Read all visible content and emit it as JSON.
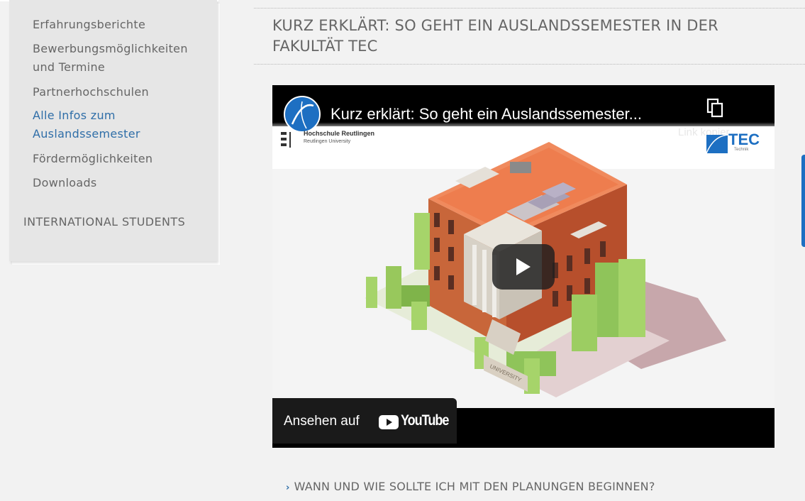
{
  "sidebar": {
    "items": [
      {
        "label": "Erfahrungsberichte"
      },
      {
        "label": "Bewerbungsmöglichkeiten und Termine"
      },
      {
        "label": "Partnerhochschulen"
      },
      {
        "label": "Alle Infos zum Auslandssemester",
        "active": true
      },
      {
        "label": "Fördermöglichkeiten"
      },
      {
        "label": "Downloads"
      }
    ],
    "section_header": "INTERNATIONAL STUDENTS"
  },
  "main": {
    "title": "KURZ ERKLÄRT: SO GEHT EIN AUSLANDSSEMESTER IN DER FAKULTÄT TEC",
    "video": {
      "title": "Kurz erklärt: So geht ein Auslandssemester...",
      "copy_link_label": "Link kopier",
      "channel_icon": "hochschule-avatar-icon",
      "university_name": "Hochschule Reutlingen",
      "university_subtitle": "Reutlingen University",
      "faculty_logo_text": "TEC",
      "faculty_logo_sub": "Technik",
      "building_sign": "UNIVERSITY",
      "watch_on_label": "Ansehen auf",
      "platform_label": "YouTube"
    },
    "faq": [
      {
        "question": "WANN UND WIE SOLLTE ICH MIT DEN PLANUNGEN BEGINNEN?"
      }
    ]
  },
  "colors": {
    "background": "#f2f2f2",
    "sidebar_bg": "#e6e6e6",
    "accent_blue": "#2f6ea8",
    "text_gray": "#666666",
    "video_chrome": "#000000"
  }
}
